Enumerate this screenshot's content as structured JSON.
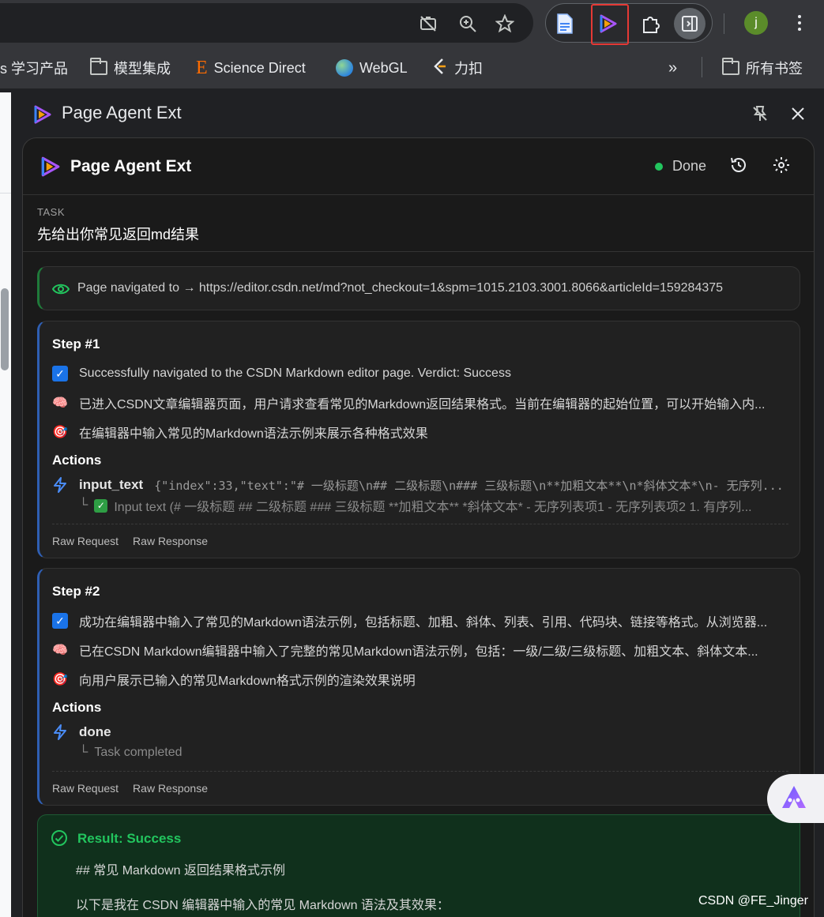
{
  "bookmarks": {
    "items": [
      {
        "label": "s 学习产品",
        "icon": "partial-icon"
      },
      {
        "label": "模型集成",
        "icon": "folder-icon"
      },
      {
        "label": "Science Direct",
        "icon": "elsevier-icon"
      },
      {
        "label": "WebGL",
        "icon": "globe-icon"
      },
      {
        "label": "力扣",
        "icon": "leetcode-icon"
      }
    ],
    "overflow": "»",
    "all_bookmarks": "所有书签"
  },
  "toolbar": {
    "avatar_initial": "j"
  },
  "side_panel": {
    "title": "Page Agent Ext"
  },
  "app": {
    "title": "Page Agent Ext",
    "status": "Done",
    "status_color": "#22c55e",
    "task_label": "TASK",
    "task_text": "先给出你常见返回md结果",
    "navigation": "Page navigated to → https://editor.csdn.net/md?not_checkout=1&spm=1015.2103.3001.8066&articleId=159284375",
    "steps": [
      {
        "title": "Step #1",
        "evaluation": "Successfully navigated to the CSDN Markdown editor page. Verdict: Success",
        "memory": "已进入CSDN文章编辑器页面，用户请求查看常见的Markdown返回结果格式。当前在编辑器的起始位置，可以开始输入内...",
        "goal": "在编辑器中输入常见的Markdown语法示例来展示各种格式效果",
        "actions_label": "Actions",
        "action_name": "input_text",
        "action_args": "{\"index\":33,\"text\":\"# 一级标题\\n## 二级标题\\n### 三级标题\\n**加粗文本**\\n*斜体文本*\\n- 无序列...",
        "action_result": "Input text (# 一级标题 ## 二级标题 ### 三级标题 **加粗文本** *斜体文本* - 无序列表项1 - 无序列表项2 1. 有序列...",
        "raw_request": "Raw Request",
        "raw_response": "Raw Response"
      },
      {
        "title": "Step #2",
        "evaluation": "成功在编辑器中输入了常见的Markdown语法示例，包括标题、加粗、斜体、列表、引用、代码块、链接等格式。从浏览器...",
        "memory": "已在CSDN Markdown编辑器中输入了完整的常见Markdown语法示例，包括：一级/二级/三级标题、加粗文本、斜体文本...",
        "goal": "向用户展示已输入的常见Markdown格式示例的渲染效果说明",
        "actions_label": "Actions",
        "action_name": "done",
        "action_result": "Task completed",
        "raw_request": "Raw Request",
        "raw_response": "Raw Response"
      }
    ],
    "result": {
      "title": "Result: Success",
      "line1": "## 常见 Markdown 返回结果格式示例",
      "line2": "以下是我在 CSDN 编辑器中输入的常见 Markdown 语法及其效果："
    }
  },
  "watermark": "CSDN @FE_Jinger"
}
